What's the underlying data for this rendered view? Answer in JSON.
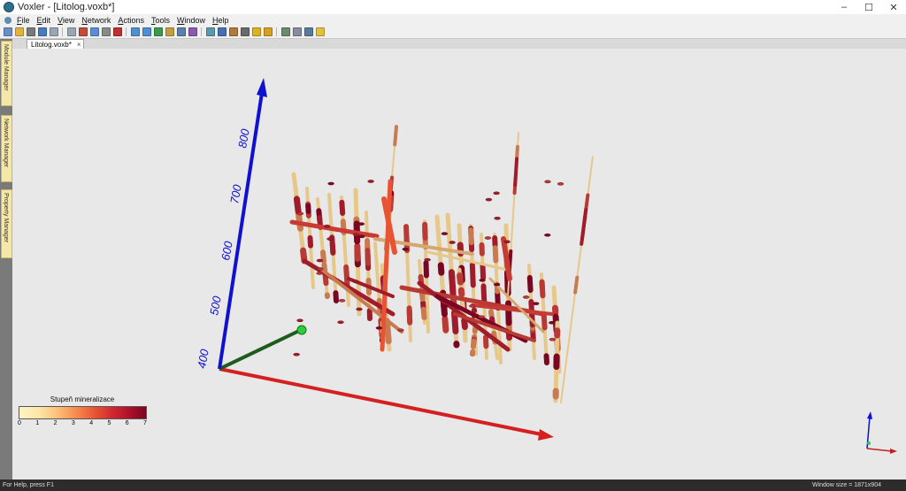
{
  "window": {
    "title": "Voxler - [Litolog.voxb*]",
    "minimize": "–",
    "maximize": "☐",
    "close": "✕"
  },
  "menu": [
    "File",
    "Edit",
    "View",
    "Network",
    "Actions",
    "Tools",
    "Window",
    "Help"
  ],
  "toolbar_icons": [
    "new-icon",
    "open-icon",
    "save-icon",
    "print-icon",
    "undo-icon",
    "redo-icon",
    "cut-icon",
    "copy-icon",
    "paste-icon",
    "delete-icon",
    "zoom-in-icon",
    "zoom-out-icon",
    "rotate-icon",
    "pan-icon",
    "fit-icon",
    "perspective-icon",
    "ortho-icon",
    "view-top-icon",
    "view-front-icon",
    "view-side-icon",
    "render-icon",
    "light-icon",
    "bounding-box-icon",
    "screenshot-icon",
    "module-icon",
    "help-icon"
  ],
  "document_tab": {
    "label": "Litolog.voxb*",
    "close": "×"
  },
  "side_tabs": [
    "Module Manager",
    "Network Manager",
    "Property Manager"
  ],
  "axes": {
    "z_ticks": [
      "400",
      "500",
      "600",
      "700",
      "800"
    ],
    "colors": {
      "x": "#d42020",
      "y": "#1f5a1f",
      "z": "#1010d0"
    }
  },
  "colorbar": {
    "title": "Stupeň mineralizace",
    "ticks": [
      "0",
      "1",
      "2",
      "3",
      "4",
      "5",
      "6",
      "7"
    ]
  },
  "status": {
    "left": "For Help, press F1",
    "right": "Window size = 1871x904"
  }
}
